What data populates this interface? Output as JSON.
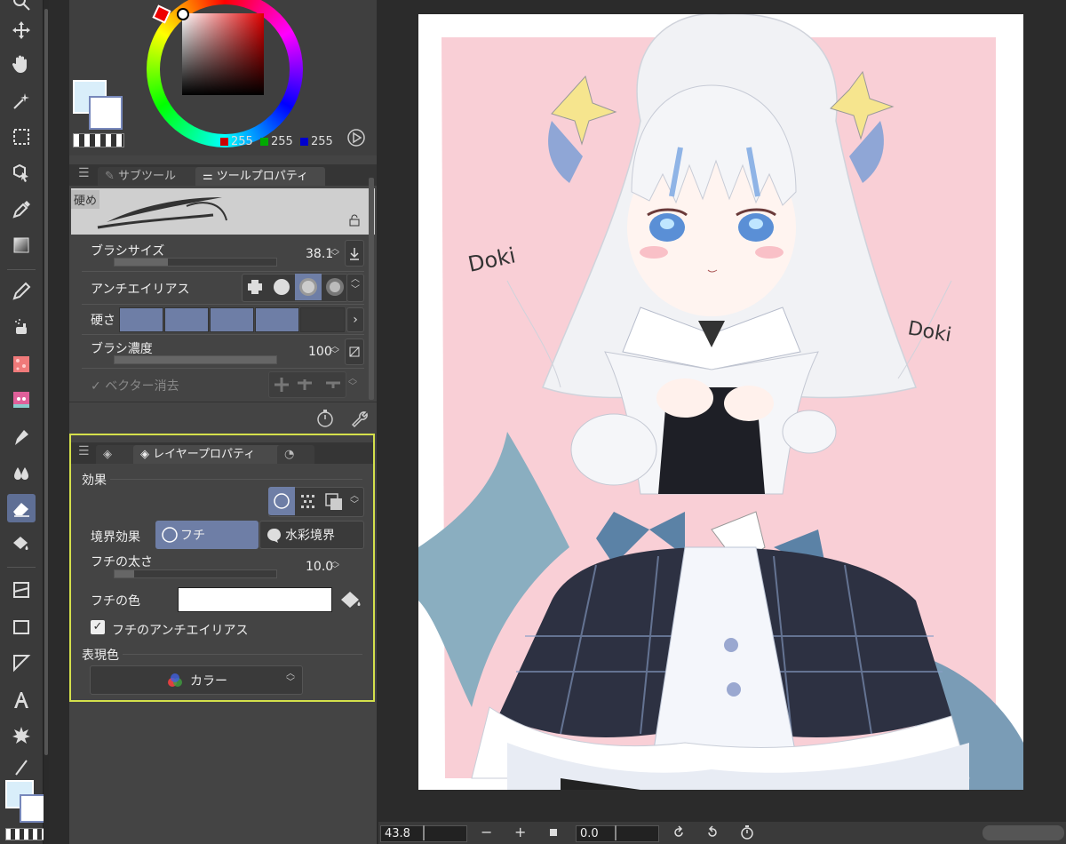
{
  "color_panel": {
    "rgb": {
      "r": "255",
      "g": "255",
      "b": "255"
    },
    "main_color": "#d9eefa",
    "sub_color": "#ffffff"
  },
  "tool_panel": {
    "tabs": [
      {
        "label": "サブツール"
      },
      {
        "label": "ツールプロパティ"
      }
    ],
    "brush_name": "硬め",
    "brush_size": {
      "label": "ブラシサイズ",
      "value": "38.1",
      "fraction": 0.33
    },
    "antialiasing": {
      "label": "アンチエイリアス"
    },
    "hardness": {
      "label": "硬さ",
      "level": 4,
      "max": 5
    },
    "density": {
      "label": "ブラシ濃度",
      "value": "100",
      "fraction": 1.0
    },
    "vector_erase": {
      "label": "ベクター消去"
    }
  },
  "layer_panel": {
    "tab_label": "レイヤープロパティ",
    "effect_title": "効果",
    "border_effect": {
      "label": "境界効果",
      "option_edge": "フチ",
      "option_watercolor": "水彩境界"
    },
    "edge_width": {
      "label": "フチの太さ",
      "value": "10.0",
      "fraction": 0.12
    },
    "edge_color": {
      "label": "フチの色",
      "color": "#ffffff"
    },
    "edge_antialias": {
      "label": "フチのアンチエイリアス",
      "checked": true
    },
    "expression_color": {
      "title": "表現色",
      "value": "カラー"
    }
  },
  "canvas": {
    "texts": {
      "doki_left": "Doki",
      "doki_right": "Doki"
    }
  },
  "status_bar": {
    "zoom": "43.8",
    "rotation": "0.0"
  },
  "colors": {
    "accent": "#6e7ea6",
    "highlight_border": "#d4e04b",
    "canvas_bg": "#fbd6dc"
  }
}
